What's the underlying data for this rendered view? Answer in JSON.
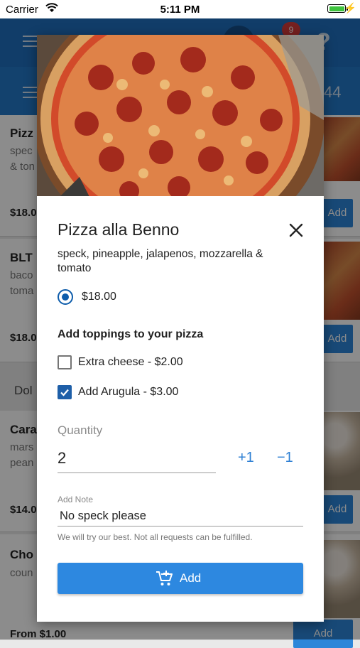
{
  "status_bar": {
    "carrier": "Carrier",
    "time": "5:11 PM"
  },
  "background": {
    "badge_count": "9",
    "cart_count": "44",
    "cards": [
      {
        "title": "Pizz",
        "desc": "spec & ton",
        "price": "$18.0",
        "add": "Add"
      },
      {
        "title": "BLT",
        "desc": "baco toma",
        "price": "$18.0",
        "add": "Add"
      },
      {
        "title": "Cara",
        "desc": "mars pean",
        "price": "$14.0",
        "add": "Add"
      },
      {
        "title": "Cho",
        "desc": "coun",
        "price": "From $1.00",
        "add": "Add"
      }
    ],
    "section": "Dol"
  },
  "dialog": {
    "title": "Pizza alla Benno",
    "description": "speck, pineapple, jalapenos, mozzarella & tomato",
    "price_option": "$18.00",
    "toppings_title": "Add toppings to your pizza",
    "toppings": [
      {
        "label": "Extra cheese - $2.00",
        "checked": false
      },
      {
        "label": "Add Arugula - $3.00",
        "checked": true
      }
    ],
    "quantity_label": "Quantity",
    "quantity_value": "2",
    "increment_label": "+1",
    "decrement_label": "−1",
    "note_label": "Add Note",
    "note_value": "No speck please",
    "note_helper": "We will try our best. Not all requests can be fulfilled.",
    "add_button_label": "Add"
  },
  "colors": {
    "primary": "#1f6fbf",
    "accent": "#2d88e0",
    "badge": "#d83b3b"
  }
}
